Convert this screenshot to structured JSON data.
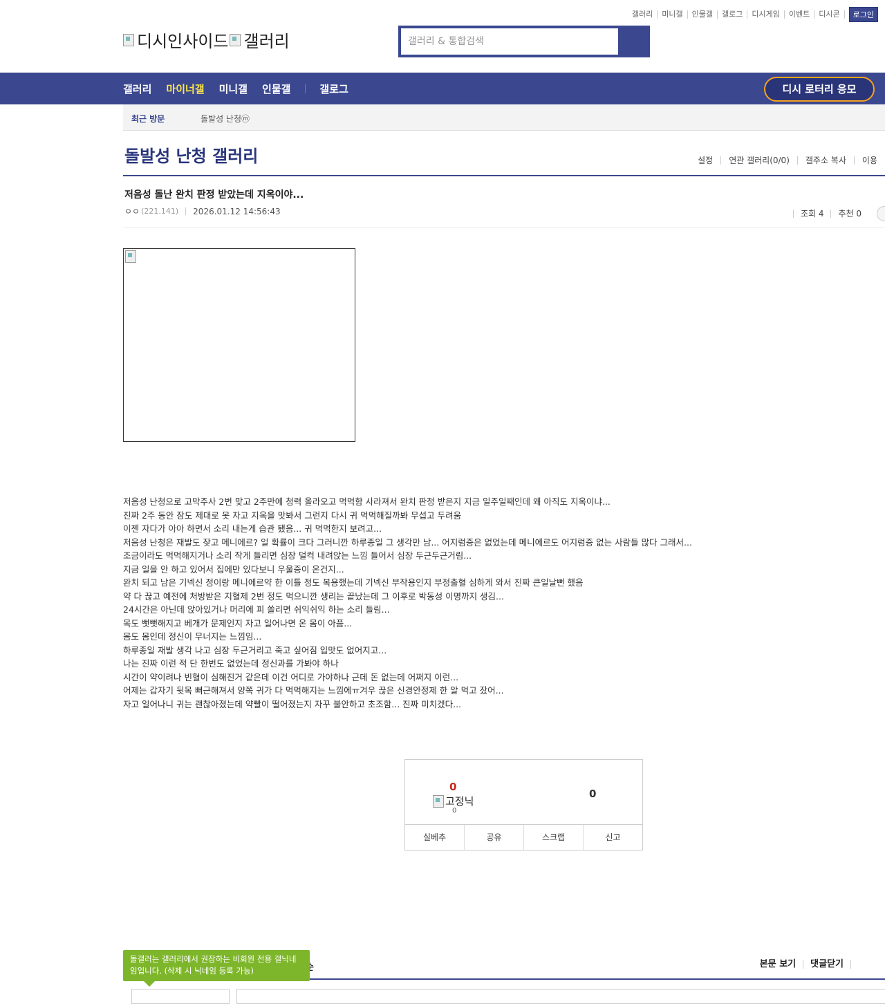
{
  "top_links": [
    "갤러리",
    "미니갤",
    "인물갤",
    "갤로그",
    "디시게임",
    "이벤트",
    "디시콘"
  ],
  "login_label": "로그인",
  "logo": {
    "alt1": "디시인사이드",
    "alt2": "갤러리"
  },
  "search": {
    "placeholder": "갤러리 & 통합검색"
  },
  "nav": {
    "items": [
      "갤러리",
      "마이너갤",
      "미니갤",
      "인물갤"
    ],
    "gallog": "갤로그",
    "lottery": "디시 로터리 응모"
  },
  "recent": {
    "label": "최근 방문",
    "gallery": "돌발성 난청ⓜ"
  },
  "gallery": {
    "title": "돌발성 난청 갤러리",
    "tools": [
      "설정",
      "연관 갤러리(0/0)",
      "갤주소 복사",
      "이용"
    ]
  },
  "post": {
    "title": "저음성 돌난 완치 판정 받았는데 지옥이야...",
    "author": "ㅇㅇ",
    "ip": "(221.141)",
    "date": "2026.01.12 14:56:43",
    "views": "조회 4",
    "recommend": "추천 0",
    "body": [
      "저음성 난청으로 고막주사 2번 맞고 2주만에 청력 올라오고 먹먹함 사라져서 완치 판정 받은지 지금 일주일째인데 왜 아직도 지옥이냐...",
      "진짜 2주 동안 잠도 제대로 못 자고 지옥을 맛봐서 그런지 다시 귀 먹먹해질까봐 무섭고 두려움",
      "이젠 자다가 아아 하면서 소리 내는게 습관 됐음... 귀 먹먹한지 보려고...",
      "저음성 난청은 재발도 잦고 메니에르? 일 확률이 크다 그러니깐 하루종일 그 생각만 남... 어지럼증은 없었는데 메니에르도 어지럼증 없는 사람들 많다 그래서...",
      "조금이라도 먹먹해지거나 소리 작게 들리면 심장 덜컥 내려앉는 느낌 들어서 심장 두근두근거림...",
      "지금 일을 안 하고 있어서 집에만 있다보니 우울증이 온건지...",
      "완치 되고 남은 기넥신 정이랑 메니에르약 한 이틀 정도 복용했는데 기넥신 부작용인지 부정출혈 심하게 와서 진짜 큰일날뻔 했음",
      "약 다 끊고 예전에 처방받은 지혈제 2번 정도 먹으니깐 생리는 끝났는데 그 이후로 박동성 이명까지 생김...",
      "24시간은 아닌데 앉아있거나 머리에 피 쏠리면 쉬익쉬익 하는 소리 들림...",
      "목도 뻣뻣해지고 베개가 문제인지 자고 일어나면 온 몸이 아픔...",
      "몸도 몸인데 정신이 무너지는 느낌임...",
      "하루종일 재발 생각 나고 심장 두근거리고 죽고 싶어짐 입맛도 없어지고...",
      "나는 진짜 이런 적 단 한번도 없었는데 정신과를 가봐야 하나",
      "시간이 약이려나 빈혈이 심해진거 같은데 이건 어디로 가야하나 근데 돈 없는데 어쩌지 이런...",
      "어제는 갑자기 뒷목 뻐근해져서 양쪽 귀가 다 먹먹해지는 느낌에ㅠ겨우 끊은 신경안정제 한 알 먹고 잤어...",
      "자고 일어나니 귀는 괜찮아졌는데 약빨이 떨어졌는지 자꾸 불안하고 초조함... 진짜 미치겠다..."
    ]
  },
  "recommend_box": {
    "up": "0",
    "fixnick_alt": "고정닉",
    "fixnick_count": "0",
    "down": "0",
    "buttons": [
      "실베추",
      "공유",
      "스크랩",
      "신고"
    ]
  },
  "comments": {
    "tooltip": "돌갤러는 갤러리에서 권장하는 비회원 전용 갤닉네임입니다. (삭제 시 닉네임 등록 가능)",
    "fragment": "순",
    "view_body": "본문 보기",
    "close_comments": "댓글닫기"
  },
  "colors": {
    "brand": "#3b4890",
    "active_nav": "#fde74a",
    "lottery_border": "#f7a31b",
    "tooltip": "#7eb62b",
    "up_count": "#c4261d"
  }
}
